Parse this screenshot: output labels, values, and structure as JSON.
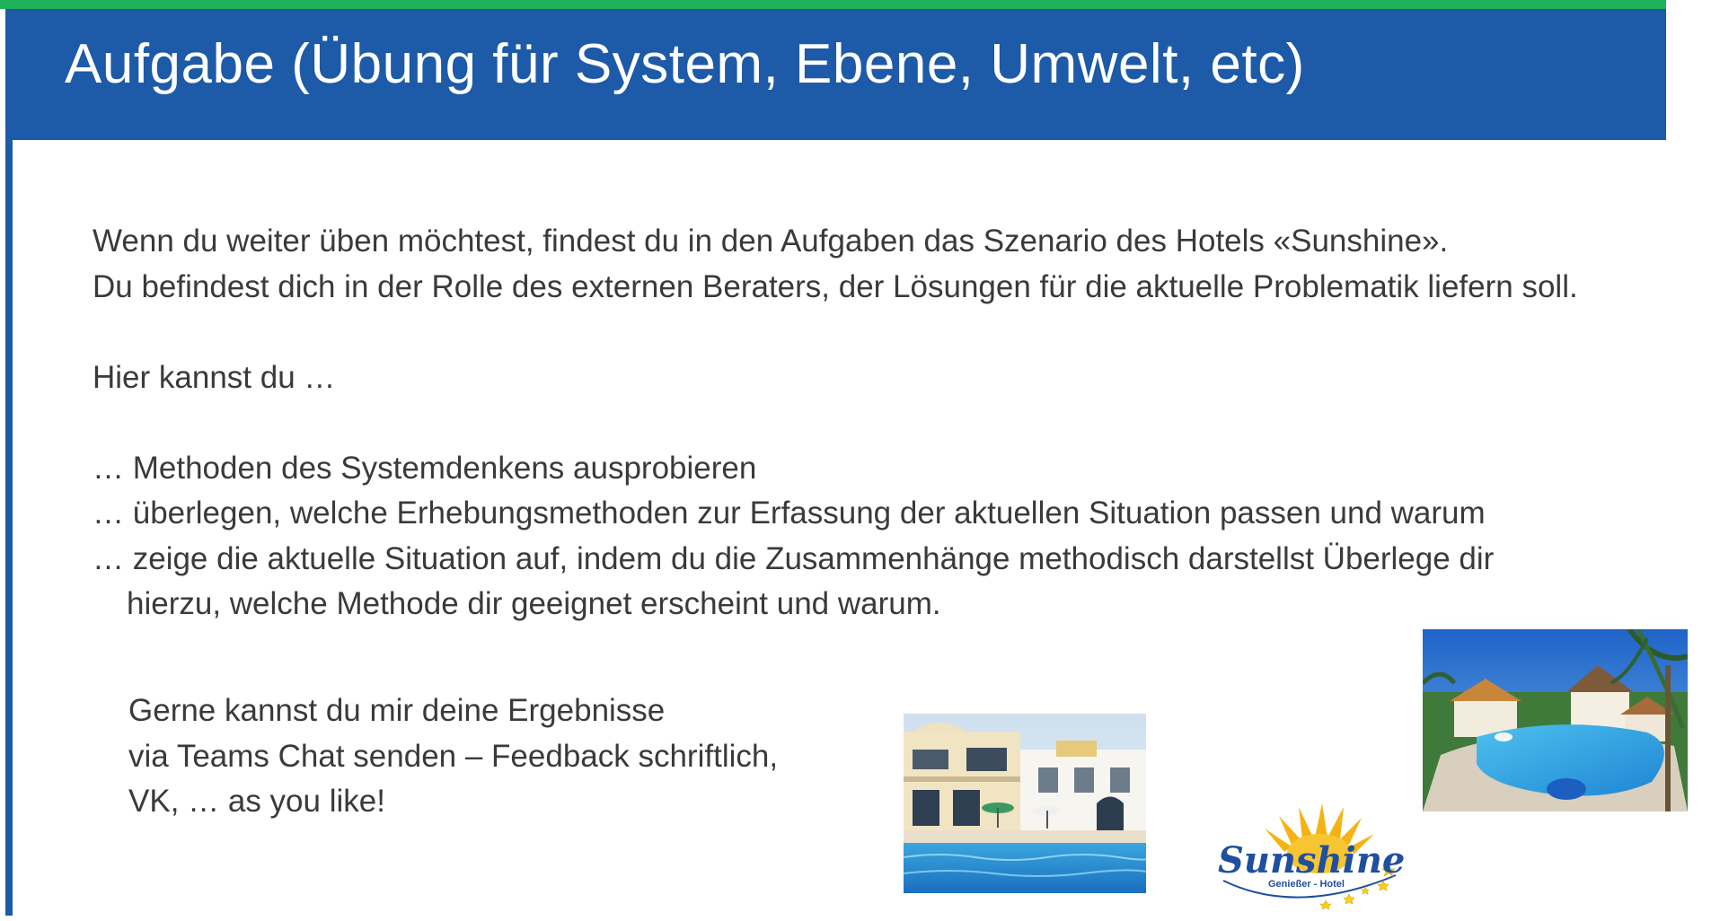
{
  "header": {
    "title": "Aufgabe (Übung für System, Ebene, Umwelt, etc)"
  },
  "intro": {
    "line1": "Wenn du weiter üben möchtest, findest du in den Aufgaben das Szenario des Hotels «Sunshine».",
    "line2": "Du befindest dich in der Rolle des externen Beraters, der Lösungen für die aktuelle Problematik liefern soll."
  },
  "lead_in": "Hier kannst du …",
  "tasks": [
    "… Methoden des Systemdenkens ausprobieren",
    "… überlegen, welche Erhebungsmethoden zur Erfassung der aktuellen Situation passen und warum",
    "… zeige die aktuelle Situation auf, indem du die Zusammenhänge methodisch darstellst Überlege dir",
    "hierzu, welche Methode dir geeignet erscheint und warum."
  ],
  "closing": {
    "line1": "Gerne kannst du mir deine Ergebnisse",
    "line2": "via Teams Chat senden – Feedback schriftlich,",
    "line3": "VK, … as you like!"
  },
  "logo": {
    "wordmark": "Sunshine",
    "tagline": "Genießer - Hotel"
  },
  "colors": {
    "header_blue": "#1d5aa8",
    "top_stripe_green": "#1fb25a",
    "body_text": "#3a3a3a",
    "logo_blue": "#1f4f9e",
    "logo_sun": "#f5b312"
  },
  "images": {
    "photo_1": "hotel-building-with-pool-photo",
    "photo_2": "resort-pool-with-palms-photo"
  }
}
